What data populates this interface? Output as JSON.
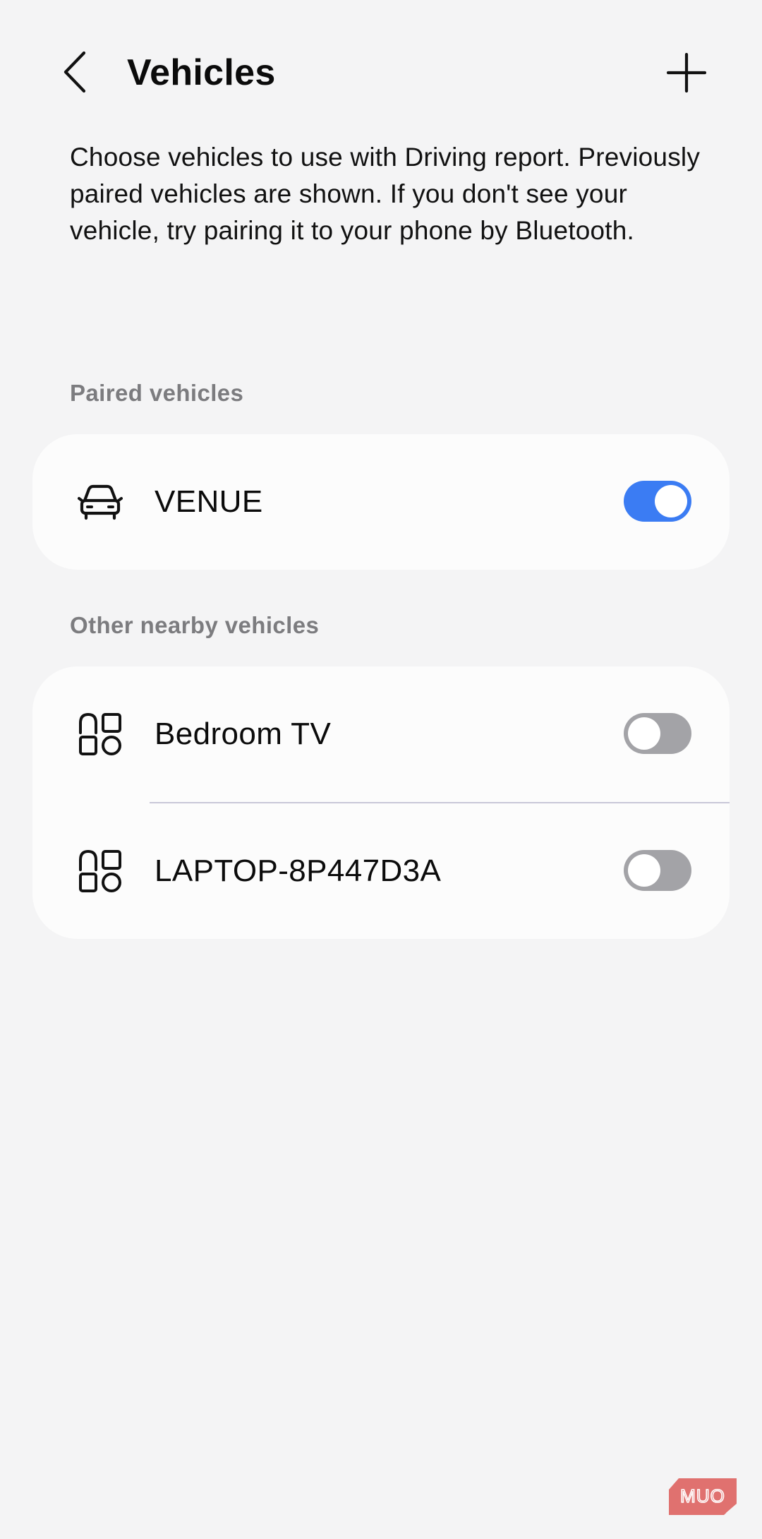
{
  "header": {
    "title": "Vehicles",
    "back_icon": "chevron-left-icon",
    "add_icon": "plus-icon"
  },
  "description": "Choose vehicles to use with Driving report. Previously paired vehicles are shown. If you don't see your vehicle, try pairing it to your phone by Bluetooth.",
  "paired": {
    "section_label": "Paired vehicles",
    "items": [
      {
        "label": "VENUE",
        "icon": "car-icon",
        "enabled": true
      }
    ]
  },
  "nearby": {
    "section_label": "Other nearby vehicles",
    "items": [
      {
        "label": "Bedroom TV",
        "icon": "devices-icon",
        "enabled": false
      },
      {
        "label": "LAPTOP-8P447D3A",
        "icon": "devices-icon",
        "enabled": false
      }
    ]
  },
  "watermark": {
    "text": "MUO"
  },
  "colors": {
    "background": "#f4f4f5",
    "card": "#fcfcfc",
    "toggle_on": "#3b7cf3",
    "toggle_off": "#a3a3a7",
    "section_label": "#7c7c7f",
    "watermark": "#e0716f"
  }
}
